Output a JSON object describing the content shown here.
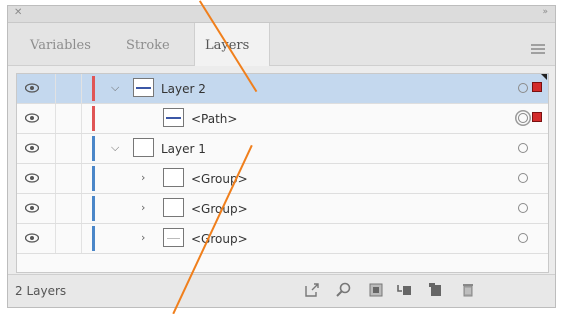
{
  "panel": {
    "close_glyph": "✕",
    "collapse_glyph": "»",
    "tabs": [
      {
        "label": "Variables",
        "active": false
      },
      {
        "label": "Stroke",
        "active": false
      },
      {
        "label": "Layers",
        "active": true
      }
    ],
    "layers": [
      {
        "name": "Layer 2",
        "indent": 0,
        "expand": "open",
        "color": "#e05555",
        "selected": true,
        "thumb": "path",
        "target": "single",
        "sel_color": "#d32b2b",
        "corner": true
      },
      {
        "name": "<Path>",
        "indent": 1,
        "expand": "none",
        "color": "#e05555",
        "selected": false,
        "thumb": "path",
        "target": "double",
        "sel_color": "#d32b2b",
        "corner": false
      },
      {
        "name": "Layer 1",
        "indent": 0,
        "expand": "open",
        "color": "#4a86c8",
        "selected": false,
        "thumb": "empty",
        "target": "single",
        "sel_color": "",
        "corner": false
      },
      {
        "name": "<Group>",
        "indent": 1,
        "expand": "closed",
        "color": "#4a86c8",
        "selected": false,
        "thumb": "empty",
        "target": "single",
        "sel_color": "",
        "corner": false
      },
      {
        "name": "<Group>",
        "indent": 1,
        "expand": "closed",
        "color": "#4a86c8",
        "selected": false,
        "thumb": "empty",
        "target": "single",
        "sel_color": "",
        "corner": false
      },
      {
        "name": "<Group>",
        "indent": 1,
        "expand": "closed",
        "color": "#4a86c8",
        "selected": false,
        "thumb": "gray",
        "target": "single",
        "sel_color": "",
        "corner": false
      }
    ],
    "footer": {
      "count": "2 Layers",
      "icons": [
        "export-icon",
        "locate-object-icon",
        "clipping-mask-icon",
        "new-sublayer-icon",
        "new-layer-icon",
        "delete-icon"
      ]
    }
  },
  "colors": {
    "annotation": "#f07f1c",
    "selection_row": "#c4d8ee",
    "layer2_color": "#e05555",
    "layer1_color": "#4a86c8"
  }
}
